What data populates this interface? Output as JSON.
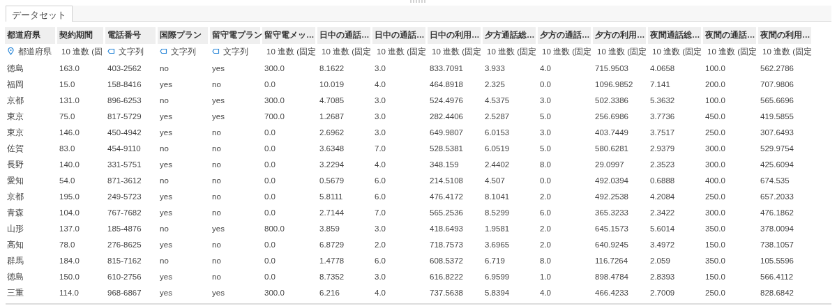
{
  "tab": {
    "label": "データセット",
    "selected": true
  },
  "columns": [
    {
      "header": "都道府県",
      "type_label": "都道府県",
      "kind": "location"
    },
    {
      "header": "契約期間",
      "type_label": "10 進数 (固",
      "kind": "number"
    },
    {
      "header": "電話番号",
      "type_label": "文字列",
      "kind": "text"
    },
    {
      "header": "国際プラン",
      "type_label": "文字列",
      "kind": "text"
    },
    {
      "header": "留守電プラン",
      "type_label": "文字列",
      "kind": "text"
    },
    {
      "header": "留守電メッ…",
      "type_label": "10 進数 (固定",
      "kind": "number"
    },
    {
      "header": "日中の通話…",
      "type_label": "10 進数 (固定",
      "kind": "number"
    },
    {
      "header": "日中の通話…",
      "type_label": "10 進数 (固定",
      "kind": "number"
    },
    {
      "header": "日中の利用…",
      "type_label": "10 進数 (固定",
      "kind": "number"
    },
    {
      "header": "夕方通話総…",
      "type_label": "10 進数 (固定",
      "kind": "number"
    },
    {
      "header": "夕方の通話…",
      "type_label": "10 進数 (固定",
      "kind": "number"
    },
    {
      "header": "夕方の利用…",
      "type_label": "10 進数 (固定",
      "kind": "number"
    },
    {
      "header": "夜間通話総…",
      "type_label": "10 進数 (固定",
      "kind": "number"
    },
    {
      "header": "夜間の通話…",
      "type_label": "10 進数 (固定",
      "kind": "number"
    },
    {
      "header": "夜間の利用…",
      "type_label": "10 進数 (固定",
      "kind": "number"
    }
  ],
  "rows": [
    [
      "徳島",
      "163.0",
      "403-2562",
      "no",
      "yes",
      "300.0",
      "8.1622",
      "3.0",
      "833.7091",
      "3.933",
      "4.0",
      "715.9503",
      "4.0658",
      "100.0",
      "562.2786"
    ],
    [
      "福岡",
      "15.0",
      "158-8416",
      "yes",
      "no",
      "0.0",
      "10.019",
      "4.0",
      "464.8918",
      "2.325",
      "0.0",
      "1096.9852",
      "7.141",
      "200.0",
      "707.9806"
    ],
    [
      "京都",
      "131.0",
      "896-6253",
      "no",
      "yes",
      "300.0",
      "4.7085",
      "3.0",
      "524.4976",
      "4.5375",
      "3.0",
      "502.3386",
      "5.3632",
      "100.0",
      "565.6696"
    ],
    [
      "東京",
      "75.0",
      "817-5729",
      "yes",
      "yes",
      "700.0",
      "1.2687",
      "3.0",
      "282.4406",
      "2.5287",
      "5.0",
      "256.6986",
      "3.7736",
      "450.0",
      "419.5855"
    ],
    [
      "東京",
      "146.0",
      "450-4942",
      "yes",
      "no",
      "0.0",
      "2.6962",
      "3.0",
      "649.9807",
      "6.0153",
      "3.0",
      "403.7449",
      "3.7517",
      "250.0",
      "307.6493"
    ],
    [
      "佐賀",
      "83.0",
      "454-9110",
      "no",
      "no",
      "0.0",
      "3.6348",
      "7.0",
      "528.5381",
      "6.0519",
      "5.0",
      "580.6281",
      "2.9379",
      "300.0",
      "529.9754"
    ],
    [
      "長野",
      "140.0",
      "331-5751",
      "yes",
      "no",
      "0.0",
      "3.2294",
      "4.0",
      "348.159",
      "2.4402",
      "8.0",
      "29.0997",
      "2.3523",
      "300.0",
      "425.6094"
    ],
    [
      "愛知",
      "54.0",
      "871-3612",
      "no",
      "no",
      "0.0",
      "0.5679",
      "6.0",
      "214.5108",
      "4.507",
      "0.0",
      "492.0394",
      "0.6888",
      "400.0",
      "674.535"
    ],
    [
      "京都",
      "195.0",
      "249-5723",
      "yes",
      "no",
      "0.0",
      "5.8111",
      "6.0",
      "476.4172",
      "8.1041",
      "2.0",
      "492.2538",
      "4.2084",
      "250.0",
      "657.2033"
    ],
    [
      "青森",
      "104.0",
      "767-7682",
      "yes",
      "no",
      "0.0",
      "2.7144",
      "7.0",
      "565.2536",
      "8.5299",
      "6.0",
      "365.3233",
      "2.3422",
      "300.0",
      "476.1862"
    ],
    [
      "山形",
      "137.0",
      "185-4876",
      "no",
      "yes",
      "800.0",
      "3.859",
      "3.0",
      "418.6493",
      "1.9581",
      "2.0",
      "645.1573",
      "5.6014",
      "350.0",
      "378.0094"
    ],
    [
      "高知",
      "78.0",
      "276-8625",
      "yes",
      "no",
      "0.0",
      "6.8729",
      "2.0",
      "718.7573",
      "3.6965",
      "2.0",
      "640.9245",
      "3.4972",
      "150.0",
      "738.1057"
    ],
    [
      "群馬",
      "184.0",
      "815-7162",
      "no",
      "no",
      "0.0",
      "1.4778",
      "6.0",
      "608.5372",
      "6.719",
      "8.0",
      "116.7264",
      "2.059",
      "350.0",
      "105.5596"
    ],
    [
      "徳島",
      "150.0",
      "610-2756",
      "yes",
      "no",
      "0.0",
      "8.7352",
      "3.0",
      "616.8222",
      "6.9599",
      "1.0",
      "898.4784",
      "2.8393",
      "150.0",
      "566.4112"
    ],
    [
      "三重",
      "114.0",
      "968-6867",
      "yes",
      "yes",
      "300.0",
      "6.216",
      "4.0",
      "737.5638",
      "5.8394",
      "4.0",
      "466.4233",
      "2.7009",
      "250.0",
      "828.6842"
    ]
  ]
}
